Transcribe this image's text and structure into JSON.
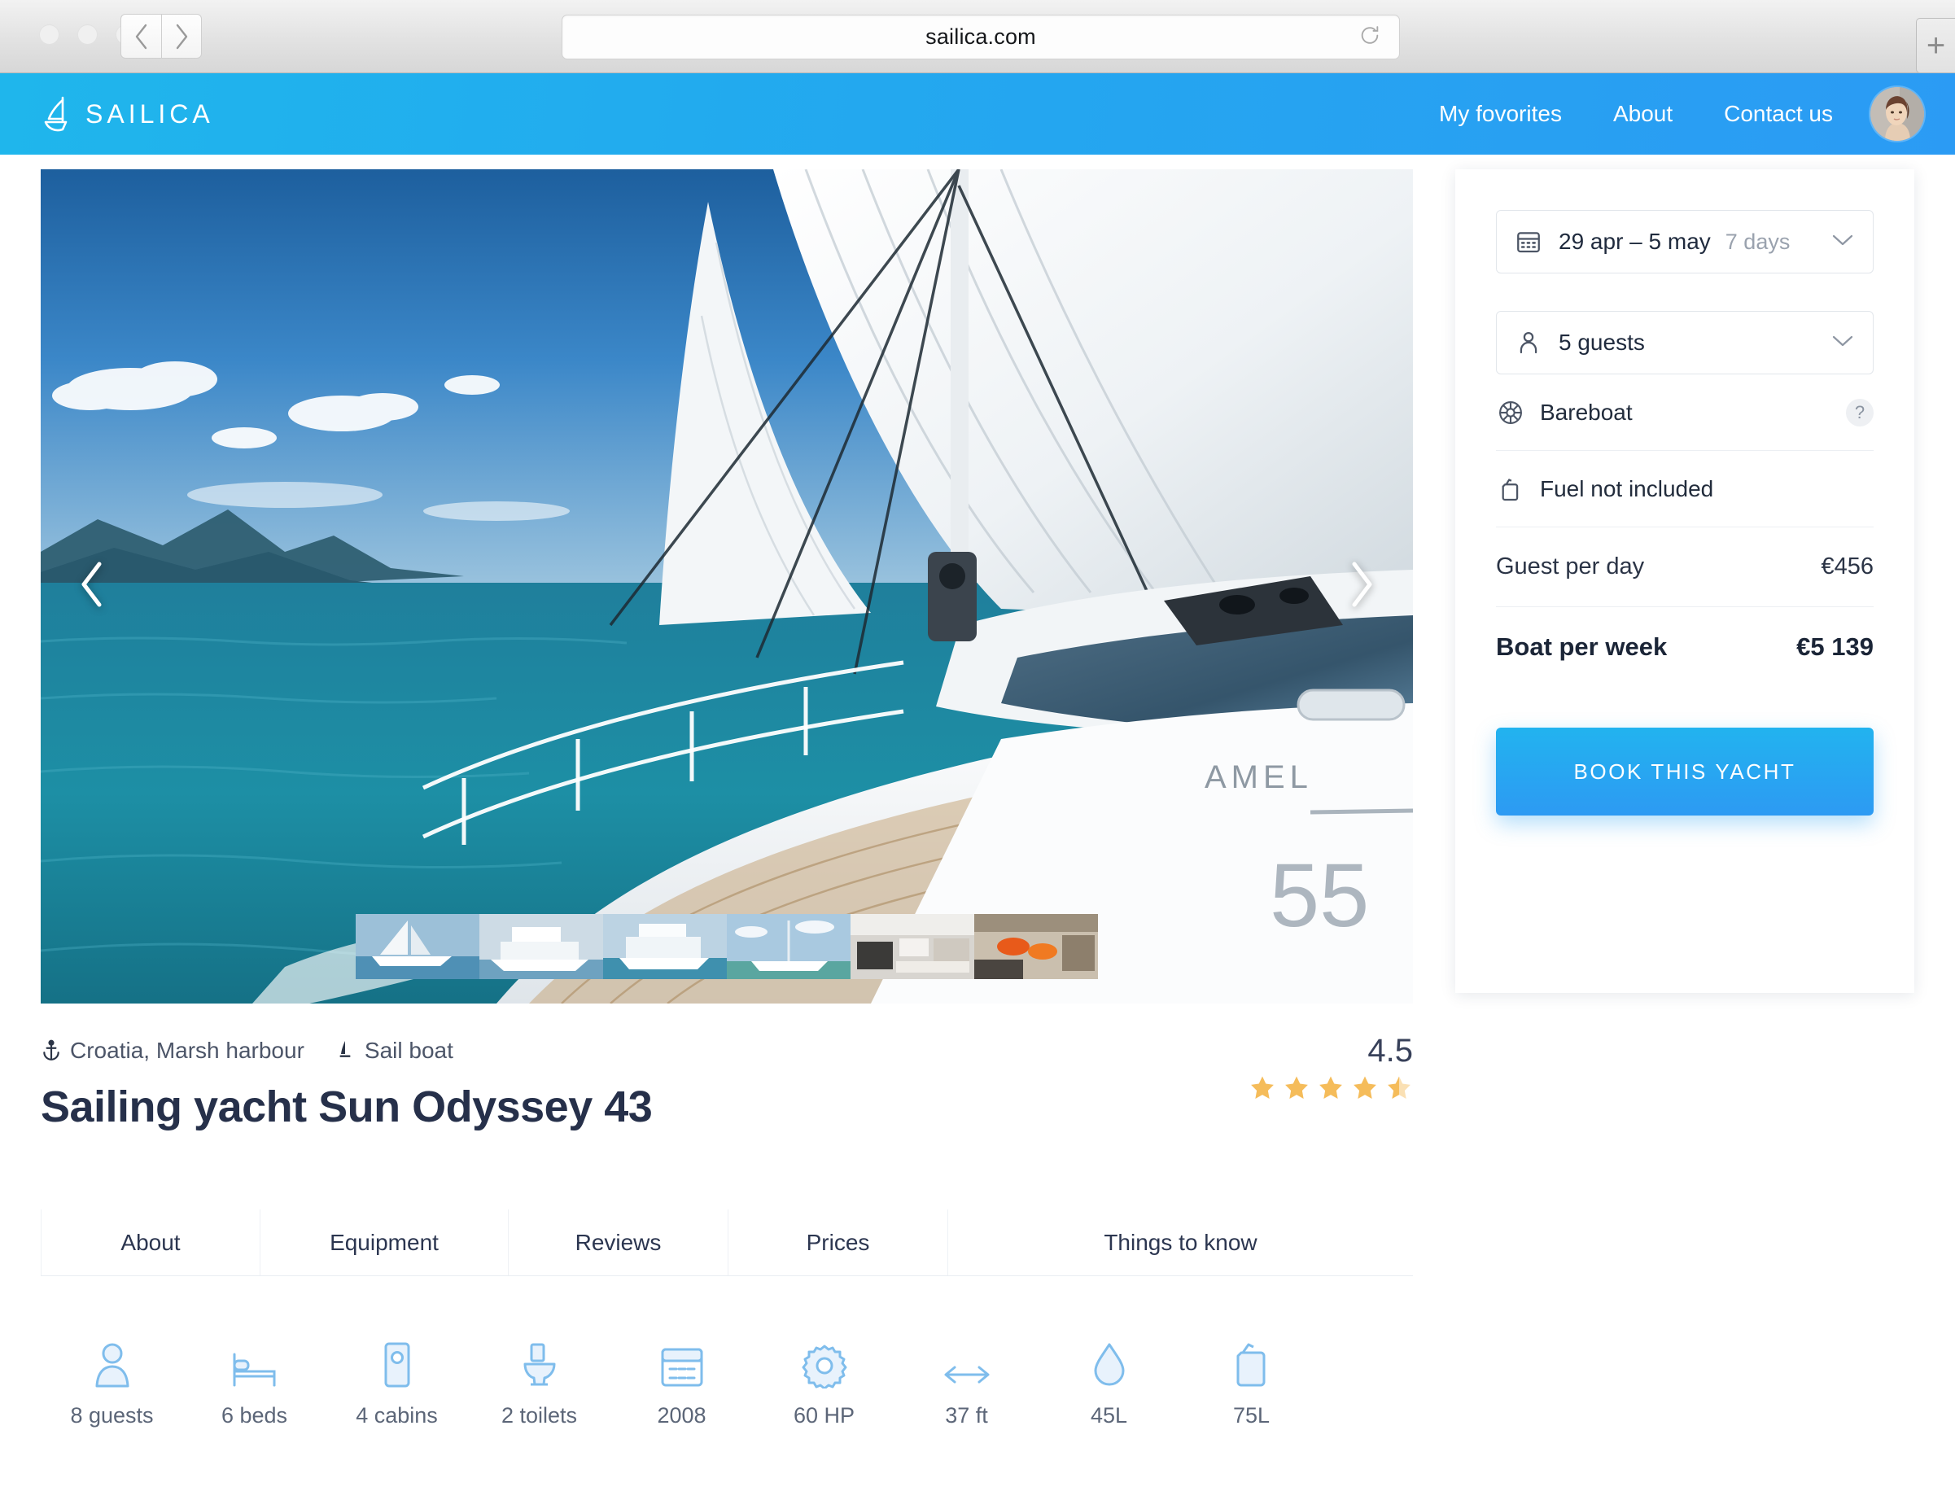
{
  "browser": {
    "url": "sailica.com",
    "back_icon": "chevron-left-icon",
    "forward_icon": "chevron-right-icon",
    "reload_icon": "reload-icon",
    "new_tab_label": "+"
  },
  "header": {
    "brand": "SAILICA",
    "nav": [
      {
        "label": "My fovorites"
      },
      {
        "label": "About"
      },
      {
        "label": "Contact us"
      }
    ],
    "avatar_alt": "user-avatar",
    "accent_color": "#22a8ef"
  },
  "gallery": {
    "prev_label": "‹",
    "next_label": "›",
    "thumbnails": [
      {
        "name": "sailing-yacht-heeling",
        "active": true
      },
      {
        "name": "motor-yacht-flybridge",
        "active": false
      },
      {
        "name": "power-catamaran",
        "active": false
      },
      {
        "name": "catamaran-at-anchor",
        "active": false
      },
      {
        "name": "interior-saloon",
        "active": false
      },
      {
        "name": "interior-cabin-lounge",
        "active": false
      }
    ]
  },
  "booking": {
    "dates": {
      "value": "29 apr – 5 may",
      "duration": "7 days",
      "icon": "calendar-icon"
    },
    "guests": {
      "value": "5 guests",
      "icon": "person-icon"
    },
    "charter_type": {
      "label": "Bareboat",
      "icon": "helm-wheel-icon",
      "help": "?"
    },
    "fuel": {
      "label": "Fuel not included",
      "icon": "fuel-can-icon"
    },
    "prices": [
      {
        "label": "Guest per day",
        "value": "€456",
        "strong": false
      },
      {
        "label": "Boat per week",
        "value": "€5 139",
        "strong": true
      }
    ],
    "cta": "BOOK THIS YACHT",
    "cta_color": "#26a9f1"
  },
  "listing": {
    "location": "Croatia, Marsh harbour",
    "boat_type": "Sail boat",
    "location_icon": "anchor-icon",
    "boat_icon": "sailboat-icon",
    "title": "Sailing yacht Sun Odyssey 43",
    "rating": "4.5",
    "stars_filled": 4,
    "stars_total": 5,
    "star_color": "#f5bc5a"
  },
  "tabs": [
    {
      "label": "About"
    },
    {
      "label": "Equipment"
    },
    {
      "label": "Reviews"
    },
    {
      "label": "Prices"
    },
    {
      "label": "Things to know"
    }
  ],
  "specs": [
    {
      "label": "8 guests",
      "icon": "person-icon"
    },
    {
      "label": "6 beds",
      "icon": "bed-icon"
    },
    {
      "label": "4 cabins",
      "icon": "cabin-door-icon"
    },
    {
      "label": "2 toilets",
      "icon": "toilet-icon"
    },
    {
      "label": "2008",
      "icon": "calendar-icon"
    },
    {
      "label": "60 HP",
      "icon": "gear-icon"
    },
    {
      "label": "37 ft",
      "icon": "length-arrows-icon"
    },
    {
      "label": "45L",
      "icon": "water-drop-icon"
    },
    {
      "label": "75L",
      "icon": "fuel-can-icon"
    }
  ]
}
